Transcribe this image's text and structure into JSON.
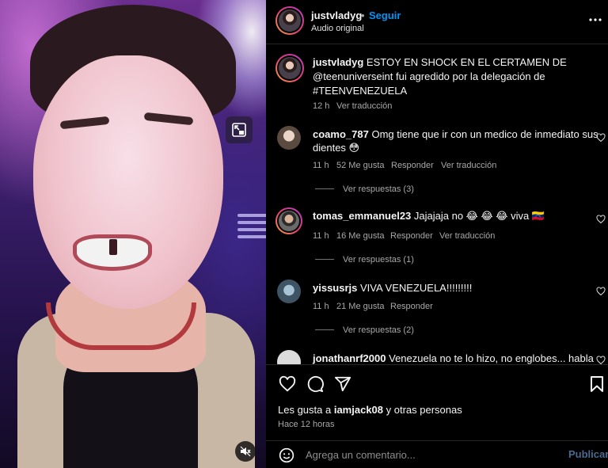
{
  "post": {
    "author": "justvladyg",
    "follow_label": "Seguir",
    "separator": "•",
    "audio": "Audio original",
    "more_icon": "more-horizontal-icon"
  },
  "caption": {
    "username": "justvladyg",
    "line1": "ESTOY EN SHOCK EN EL CERTAMEN DE",
    "line2": "@teenuniverseint fui agredido por la delegación de",
    "line3": "#TEENVENEZUELA",
    "time": "12 h",
    "translate": "Ver traducción"
  },
  "comments": [
    {
      "username": "coamo_787",
      "text_line1": "Omg tiene que ir con un medico de inmediato sus",
      "text_line2": "dientes 😳",
      "time": "11 h",
      "likes": "52 Me gusta",
      "reply": "Responder",
      "translate": "Ver traducción",
      "replies": "Ver respuestas (3)"
    },
    {
      "username": "tomas_emmanuel23",
      "text_line1": "Jajajaja no 😂 😂 😂  viva 🇻🇪",
      "time": "11 h",
      "likes": "16 Me gusta",
      "reply": "Responder",
      "translate": "Ver traducción",
      "replies": "Ver respuestas (1)"
    },
    {
      "username": "yissusrjs",
      "text_line1": "VIVA VENEZUELA!!!!!!!!!",
      "time": "11 h",
      "likes": "21 Me gusta",
      "reply": "Responder",
      "replies": "Ver respuestas (2)"
    },
    {
      "username": "jonathanrf2000",
      "text_line1": "Venezuela no te lo hizo, no englobes... habla"
    }
  ],
  "actions": {
    "liked_prefix": "Les gusta a",
    "liked_user": "iamjack08",
    "liked_suffix": "y otras personas",
    "time_ago": "Hace 12 horas"
  },
  "add_comment": {
    "placeholder": "Agrega un comentario...",
    "submit": "Publicar"
  },
  "media": {
    "pip_icon": "picture-in-picture-icon",
    "mute_icon": "muted-speaker-icon"
  },
  "colors": {
    "background": "#000000",
    "accent": "#0095f6",
    "muted_text": "#a8a8a8",
    "divider": "#262626"
  }
}
